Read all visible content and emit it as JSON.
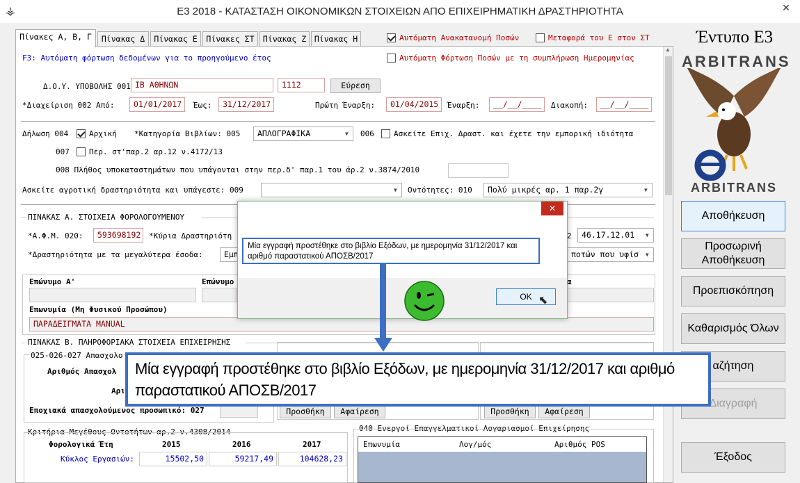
{
  "window": {
    "title": "Ε3 2018 - ΚΑΤΑΣΤΑΣΗ ΟΙΚΟΝΟΜΙΚΩΝ ΣΤΟΙΧΕΙΩΝ ΑΠΟ ΕΠΙΧΕΙΡΗΜΑΤΙΚΗ ΔΡΑΣΤΗΡΙΟΤΗΤΑ",
    "close": "✕"
  },
  "tabs": [
    "Πίνακες Α, Β, Γ",
    "Πίνακας Δ",
    "Πίνακας Ε",
    "Πίνακες ΣΤ",
    "Πίνακας Ζ",
    "Πίνακας Η"
  ],
  "top_options": {
    "auto_redistribution": "Αυτόματη Ανακατανομή Ποσών",
    "transfer_e": "Μεταφορά του Ε στον ΣΤ",
    "f3_hint": "F3: Αυτόματη φόρτωση δεδομένων για το προηγούμενο έτος",
    "auto_load_dates": "Αυτόματη Φόρτωση Ποσών με τη συμπλήρωση Ημερομηνίας"
  },
  "form": {
    "doy_label": "Δ.Ο.Υ. ΥΠΟΒΟΛΗΣ 001:",
    "doy_value": "ΙΒ ΑΘΗΝΩΝ",
    "doy_code": "1112",
    "search_button": "Εύρεση",
    "mgmt_label": "*Διαχείριση  002 Από:",
    "from_date": "01/01/2017",
    "to_label": "Έως:",
    "to_date": "31/12/2017",
    "first_start_label": "Πρώτη Έναρξη:",
    "first_start": "01/04/2015",
    "start_label": "Έναρξη:",
    "start_value": "__/__/____",
    "stop_label": "Διακοπή:",
    "stop_value": "__/__/____",
    "decl_label": "Δήλωση 004",
    "initial_label": "Αρχική",
    "books_label": "*Κατηγορία Βιβλίων: 005",
    "books_value": "ΑΠΛΟΓΡΑΦΙΚΑ",
    "code006": "006",
    "commercial_label": "Ασκείτε Επιχ. Δραστ. και έχετε την εμπορική ιδιότητα",
    "code007": "007",
    "par2_label": "Περ. στ'παρ.2 αρ.12 ν.4172/13",
    "branches_label": "008 Πλήθος υποκαταστημάτων που υπάγονται στην περ.δ' παρ.1 του άρ.2 ν.3874/2010",
    "agri_label": "Ασκείτε αγροτική δραστηριότητα και υπάγεστε: 009",
    "entities_label": "Οντότητες: 010",
    "entities_value": "Πολύ μικρές αρ. 1 παρ.2γ",
    "tableA_title": "ΠΙΝΑΚΑΣ Α. ΣΤΟΙΧΕΙΑ ΦΟΡΟΛΟΓΟΥΜΕΝΟΥ",
    "afm_label": "*Α.Φ.Μ. 020:",
    "afm_value": "593698192",
    "main_activity_label": "*Κύρια Δραστηριότη",
    "kad_code": "2",
    "kad_value": "46.17.12.01",
    "top_income_label": "*Δραστηριότητα με τα μεγαλύτερα έσοδα:",
    "top_income_value": "Εμπ",
    "top_income_right": "ποτών που υφίσ",
    "surname_a": "Επώνυμο Α'",
    "surname_b": "Επώνυμο",
    "surname_c": "α",
    "company_label": "Επωνυμία (Μη Φυσικού Προσώπου)",
    "company_value": "ΠΑΡΑΔΕΙΓΜΑΤΑ MANUAL",
    "tableB_title": "ΠΙΝΑΚΑΣ Β. ΠΛΗΡΟΦΟΡΙΑΚΑ ΣΤΟΙΧΕΙΑ ΕΠΙΧΕΙΡΗΣΗΣ",
    "employ_group": "025-026-027 Απασχολο",
    "employ_count": "Αριθμός Απασχολ",
    "employ_ar": "Αρι",
    "seasonal_label": "Εποχιακά απασχολούμενος προσωπικό: 027",
    "add_button": "Προσθήκη",
    "remove_button": "Αφαίρεση",
    "size_title": "Κριτήρια Μεγέθους Οντοτήτων αρ.2 ν.4308/2014",
    "tax_years": "Φορολογικά Έτη",
    "y2015": "2015",
    "y2016": "2016",
    "y2017": "2017",
    "turnover_label": "Κύκλος Εργασιών:",
    "t2015": "15502,50",
    "t2016": "59217,49",
    "t2017": "104628,23",
    "accounts_title": "040 Ενεργοί Επαγγελματικοί Λογαριασμοί Επιχείρησης",
    "col_name": "Επωνυμία",
    "col_account": "Λογ/μός",
    "col_pos": "Αριθμός POS"
  },
  "sidebar": {
    "title": "Έντυπο Ε3",
    "brand": "ARBITRANS",
    "buttons": [
      "Αποθήκευση",
      "Προσωρινή Αποθήκευση",
      "Προεπισκόπηση",
      "Καθαρισμός Όλων",
      "αζήτηση",
      "Διαγραφή",
      "Έξοδος"
    ]
  },
  "dialog": {
    "message": "Μία εγγραφή προστέθηκε στο βιβλίο Εξόδων, με ημερομηνία 31/12/2017 και αριθμό παραστατικού ΑΠΟΣΒ/2017",
    "ok": "OK",
    "close": "✕"
  },
  "callout": {
    "message": "Μία εγγραφή προστέθηκε στο βιβλίο Εξόδων, με ημερομηνία 31/12/2017 και αριθμό παραστατικού ΑΠΟΣΒ/2017"
  },
  "colors": {
    "accent_blue": "#3c6fc2",
    "smiley": "#3dbb2f",
    "red_text": "#c00000"
  }
}
